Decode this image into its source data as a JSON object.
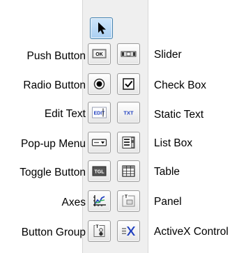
{
  "palette": {
    "pointer": {
      "label": ""
    },
    "rows": [
      {
        "left": {
          "label": "Push Button",
          "icon": "push-button-icon"
        },
        "right": {
          "label": "Slider",
          "icon": "slider-icon"
        }
      },
      {
        "left": {
          "label": "Radio Button",
          "icon": "radio-button-icon"
        },
        "right": {
          "label": "Check Box",
          "icon": "check-box-icon"
        }
      },
      {
        "left": {
          "label": "Edit Text",
          "icon": "edit-text-icon"
        },
        "right": {
          "label": "Static Text",
          "icon": "static-text-icon"
        }
      },
      {
        "left": {
          "label": "Pop-up Menu",
          "icon": "popup-menu-icon"
        },
        "right": {
          "label": "List Box",
          "icon": "list-box-icon"
        }
      },
      {
        "left": {
          "label": "Toggle Button",
          "icon": "toggle-button-icon"
        },
        "right": {
          "label": "Table",
          "icon": "table-icon"
        }
      },
      {
        "left": {
          "label": "Axes",
          "icon": "axes-icon"
        },
        "right": {
          "label": "Panel",
          "icon": "panel-icon"
        }
      },
      {
        "left": {
          "label": "Button Group",
          "icon": "button-group-icon"
        },
        "right": {
          "label": "ActiveX Control",
          "icon": "activex-control-icon"
        }
      }
    ],
    "glyphs": {
      "ok": "OK",
      "edit": "EDIT",
      "txt": "TXT",
      "tgl": "TGL",
      "t": "T"
    },
    "colors": {
      "selected_bg": "#a9cff2",
      "accent_blue": "#1f3fbf",
      "strip_bg": "#efefef"
    }
  }
}
